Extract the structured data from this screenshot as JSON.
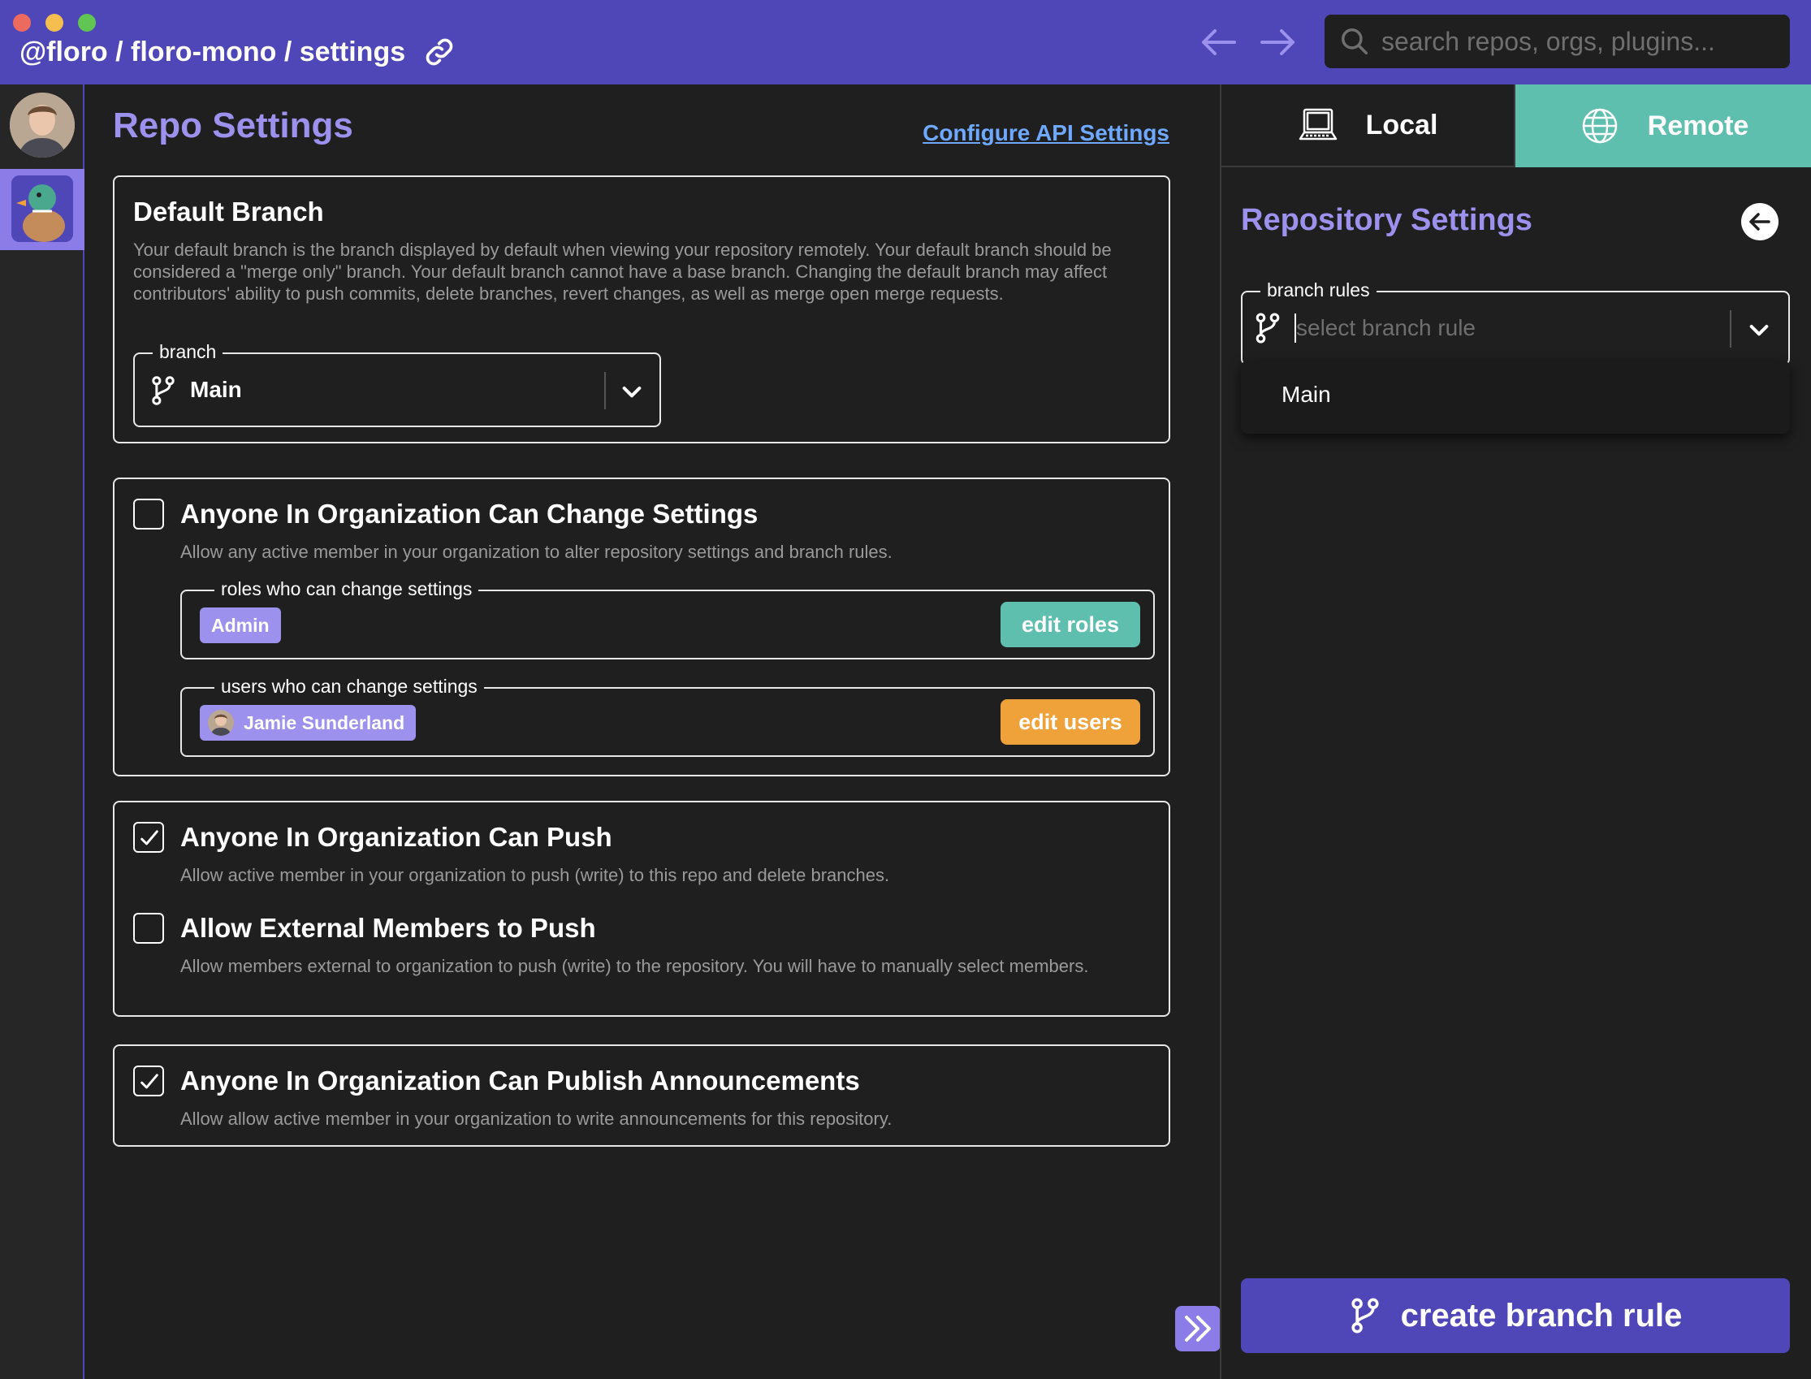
{
  "window": {
    "breadcrumb": "@floro / floro-mono / settings",
    "search_placeholder": "search repos, orgs, plugins..."
  },
  "main": {
    "title": "Repo Settings",
    "api_link": "Configure API Settings",
    "default_branch": {
      "heading": "Default Branch",
      "description": "Your default branch is the branch displayed by default when viewing your repository remotely. Your default branch should be considered a \"merge only\" branch. Your default branch cannot have a base branch. Changing the default branch may affect contributors' ability to push commits, delete branches, revert changes, as well as merge open merge requests.",
      "field_label": "branch",
      "selected": "Main"
    },
    "change_settings": {
      "heading": "Anyone In Organization Can Change Settings",
      "description": "Allow any active member in your organization to alter repository settings and branch rules.",
      "checked": false,
      "roles_label": "roles who can change settings",
      "roles": [
        "Admin"
      ],
      "edit_roles": "edit roles",
      "users_label": "users who can change settings",
      "users": [
        "Jamie Sunderland"
      ],
      "edit_users": "edit users"
    },
    "push": {
      "heading": "Anyone In Organization Can Push",
      "description": "Allow active member in your organization to push (write) to this repo and delete branches.",
      "checked": true,
      "external_heading": "Allow External Members to Push",
      "external_description": "Allow members external to organization to push (write) to the repository. You will have to manually select members.",
      "external_checked": false
    },
    "announcements": {
      "heading": "Anyone In Organization Can Publish Announcements",
      "description": "Allow allow active member in your organization to write announcements for this repository.",
      "checked": true
    }
  },
  "panel": {
    "tabs": [
      {
        "label": "Local",
        "active": false
      },
      {
        "label": "Remote",
        "active": true
      }
    ],
    "title": "Repository Settings",
    "branch_rules_label": "branch rules",
    "branch_rules_placeholder": "select branch rule",
    "options": [
      "Main"
    ],
    "create_button": "create branch rule"
  },
  "colors": {
    "brand": "#4f46b8",
    "accent_purple": "#9d91ee",
    "teal": "#5fbfae",
    "orange": "#f0a23a",
    "link": "#6fa8ff"
  },
  "icons": [
    "link-icon",
    "arrow-left-icon",
    "arrow-right-icon",
    "search-icon",
    "branch-icon",
    "chevron-down-icon",
    "checkmark-icon",
    "laptop-icon",
    "globe-icon",
    "double-chevron-right-icon"
  ]
}
